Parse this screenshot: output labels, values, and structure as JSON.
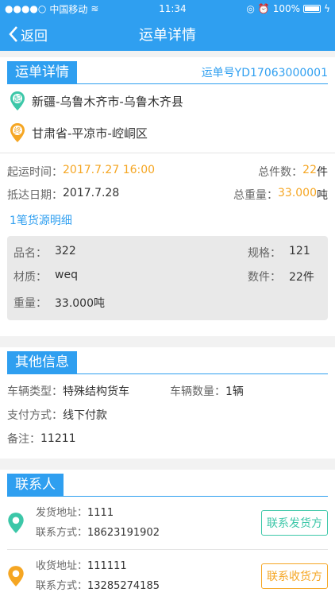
{
  "status": {
    "carrier": "中国移动",
    "time": "11:34",
    "battery": "100%"
  },
  "nav": {
    "back": "返回",
    "title": "运单详情"
  },
  "waybill": {
    "section": "运单详情",
    "number": "运单号YD17063000001",
    "origin_badge": "起",
    "origin": "新疆-乌鲁木齐市-乌鲁木齐县",
    "dest_badge": "终",
    "destination": "甘肃省-平凉市-崆峒区",
    "start_label": "起运时间：",
    "start_value": "2017.7.27 16:00",
    "count_label": "总件数：",
    "count_value": "22",
    "count_unit": "件",
    "arrive_label": "抵达日期：",
    "arrive_value": "2017.7.28",
    "weight_label": "总重量：",
    "weight_value": "33.000",
    "weight_unit": "吨",
    "detail_link": "1笔货源明细",
    "cargo": {
      "name_label": "品名：",
      "name": "322",
      "spec_label": "规格：",
      "spec": "121",
      "material_label": "材质：",
      "material": "weq",
      "pieces_label": "数件：",
      "pieces": "22件",
      "weight_label": "重量：",
      "weight": "33.000吨"
    }
  },
  "other": {
    "section": "其他信息",
    "vehicle_type_label": "车辆类型：",
    "vehicle_type": "特殊结构货车",
    "vehicle_count_label": "车辆数量：",
    "vehicle_count": "1辆",
    "payment_label": "支付方式：",
    "payment": "线下付款",
    "note_label": "备注：",
    "note": "11211"
  },
  "contacts": {
    "section": "联系人",
    "sender": {
      "addr_label": "发货地址：",
      "addr": "1111",
      "phone_label": "联系方式：",
      "phone": "18623191902",
      "button": "联系发货方"
    },
    "receiver": {
      "addr_label": "收货地址：",
      "addr": "111111",
      "phone_label": "联系方式：",
      "phone": "13285274185",
      "button": "联系收货方"
    }
  },
  "colors": {
    "primary": "#2f9ff0",
    "orange": "#f5a623",
    "green": "#3cc7a8"
  }
}
